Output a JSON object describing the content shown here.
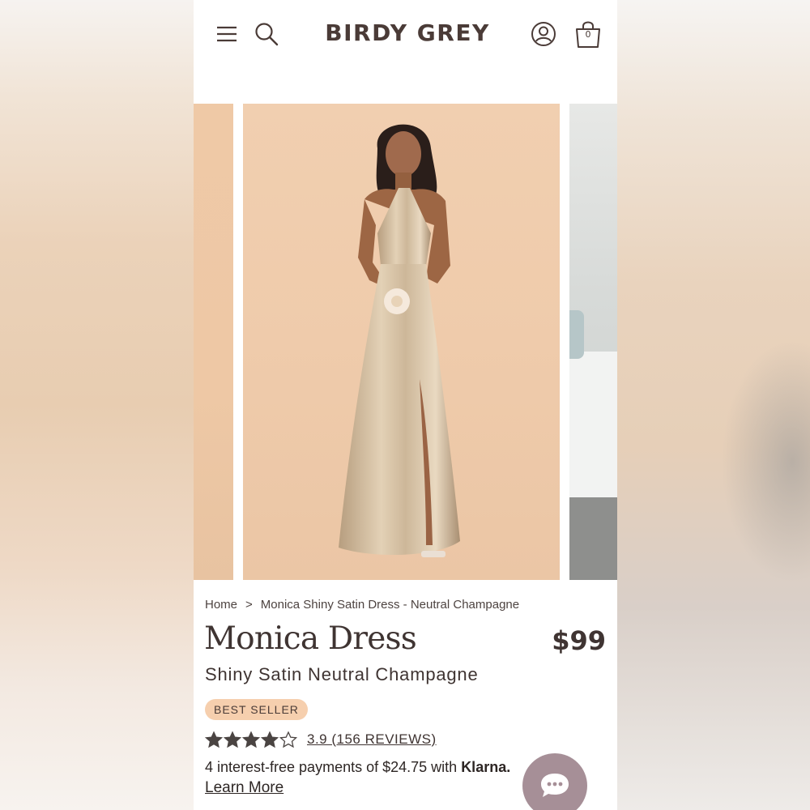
{
  "header": {
    "brand": "BIRDY GREY",
    "cart_count": "0"
  },
  "icons": {
    "menu": "hamburger-icon",
    "search": "search-icon",
    "account": "user-icon",
    "cart": "shopping-bag-icon",
    "chat": "chat-bubble-icon",
    "star": "star-icon"
  },
  "breadcrumb": {
    "home": "Home",
    "separator": ">",
    "current": "Monica Shiny Satin Dress - Neutral Champagne"
  },
  "product": {
    "title": "Monica Dress",
    "price": "$99",
    "subtitle": "Shiny Satin Neutral Champagne",
    "badge": "BEST SELLER",
    "rating": 3.9,
    "rating_text": "3.9 (156 REVIEWS)",
    "installments_text": "4 interest-free payments of $24.75 with",
    "installments_provider": "Klarna.",
    "learn_more": "Learn More"
  },
  "colors": {
    "brand_text": "#4a3b37",
    "badge_bg": "#f6cfae",
    "chat_button": "#a68f97",
    "stars": "#4a4442"
  }
}
